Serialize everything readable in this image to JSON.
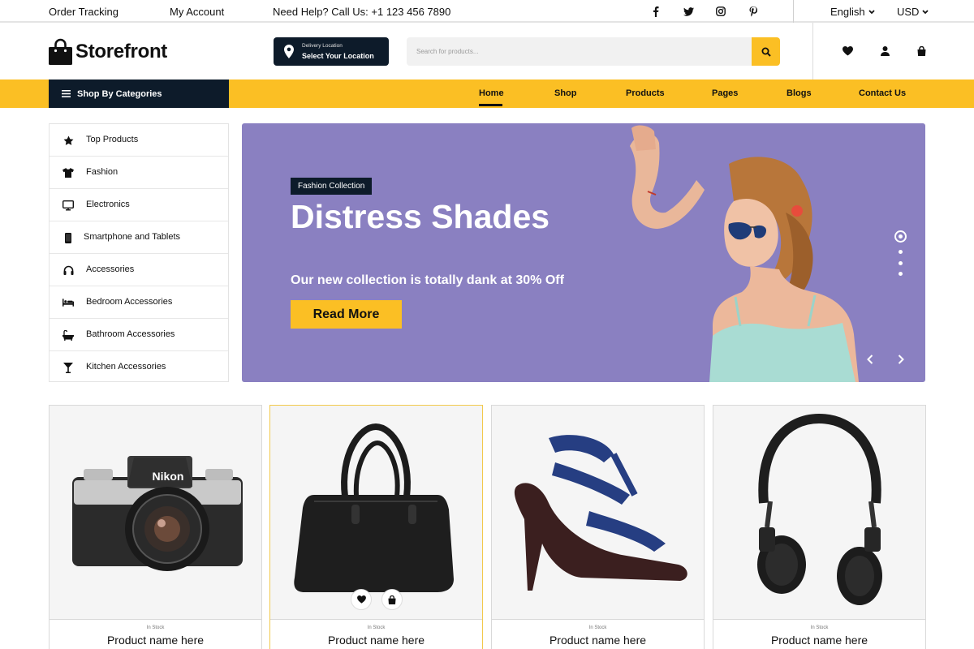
{
  "topbar": {
    "order_tracking": "Order Tracking",
    "my_account": "My Account",
    "help": "Need Help? Call Us: +1 123 456 7890",
    "social": [
      "facebook-icon",
      "twitter-icon",
      "instagram-icon",
      "pinterest-icon"
    ],
    "language": "English",
    "currency": "USD"
  },
  "header": {
    "logo_text": "Storefront",
    "location": {
      "label": "Delivery Location",
      "value": "Select Your Location"
    },
    "search_placeholder": "Search for products...",
    "icons": [
      "heart-icon",
      "user-icon",
      "cart-icon"
    ]
  },
  "nav": {
    "categories_button": "Shop By Categories",
    "items": [
      "Home",
      "Shop",
      "Products",
      "Pages",
      "Blogs",
      "Contact Us"
    ],
    "active": "Home"
  },
  "sidebar": {
    "items": [
      {
        "label": "Top Products",
        "icon": "star-icon"
      },
      {
        "label": "Fashion",
        "icon": "shirt-icon"
      },
      {
        "label": "Electronics",
        "icon": "monitor-icon"
      },
      {
        "label": "Smartphone and Tablets",
        "icon": "phone-icon"
      },
      {
        "label": "Accessories",
        "icon": "headphones-icon"
      },
      {
        "label": "Bedroom Accessories",
        "icon": "bed-icon"
      },
      {
        "label": "Bathroom Accessories",
        "icon": "bath-icon"
      },
      {
        "label": "Kitchen Accessories",
        "icon": "cocktail-icon"
      }
    ]
  },
  "hero": {
    "badge": "Fashion Collection",
    "title": "Distress Shades",
    "subtitle": "Our new collection is totally dank at 30% Off",
    "button": "Read More",
    "background": "#8a80c1"
  },
  "products": [
    {
      "stock": "In Stock",
      "name": "Product name here",
      "image": "camera"
    },
    {
      "stock": "In Stock",
      "name": "Product name here",
      "image": "handbag"
    },
    {
      "stock": "In Stock",
      "name": "Product name here",
      "image": "high-heel"
    },
    {
      "stock": "In Stock",
      "name": "Product name here",
      "image": "headphones"
    }
  ],
  "colors": {
    "accent": "#fbbf24",
    "dark": "#0d1b2a"
  }
}
